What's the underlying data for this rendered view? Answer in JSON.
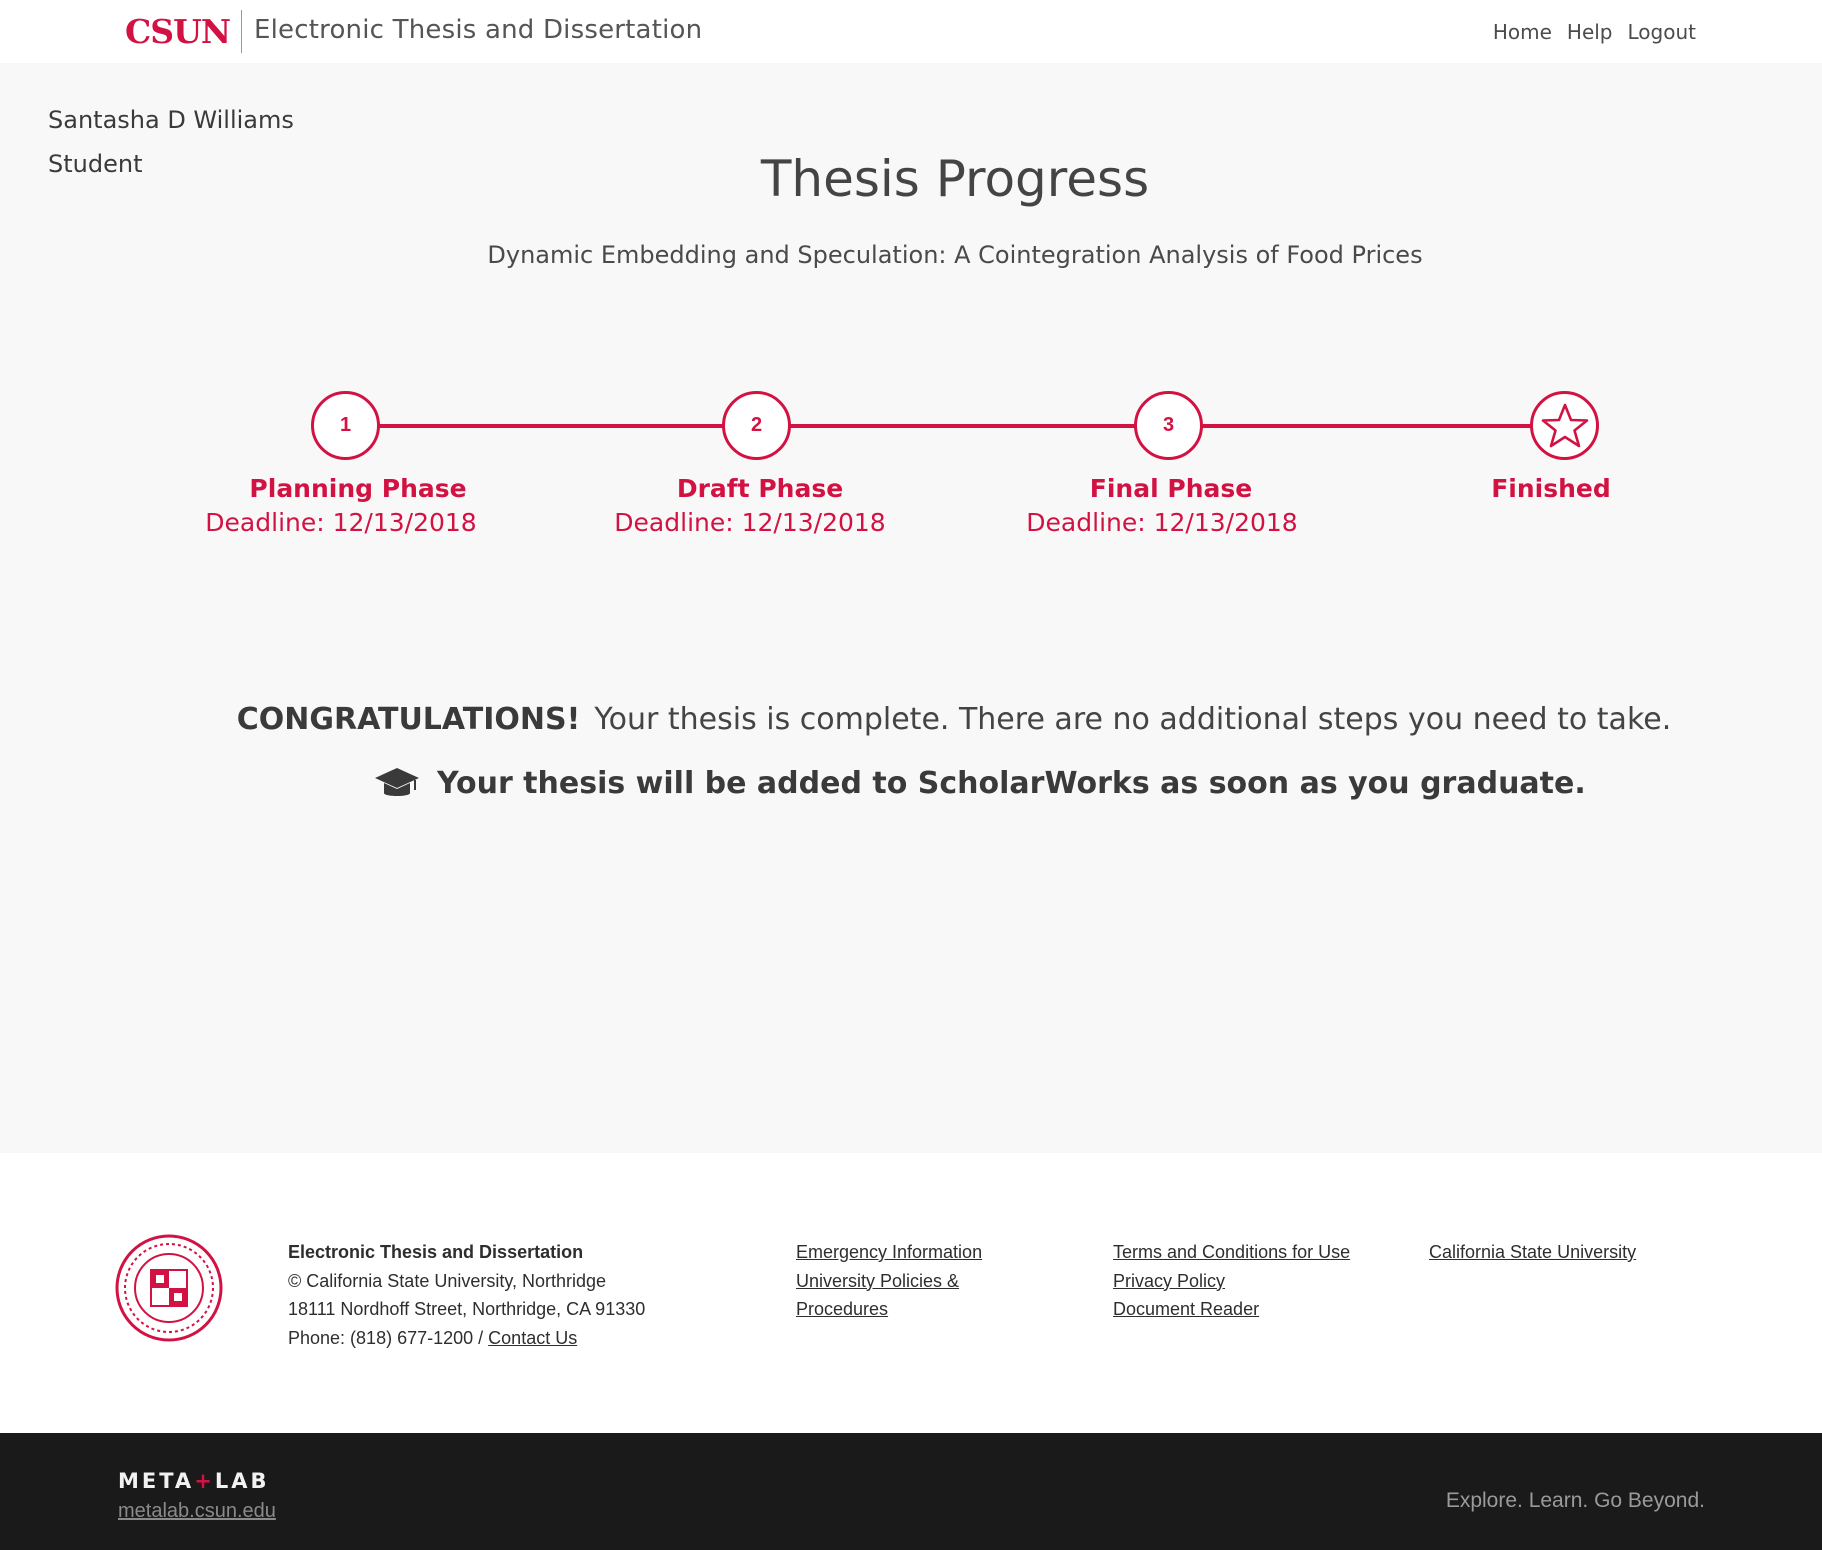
{
  "header": {
    "logo": "CSUN",
    "app_title": "Electronic Thesis and Dissertation",
    "nav": [
      {
        "label": "Home"
      },
      {
        "label": "Help"
      },
      {
        "label": "Logout"
      }
    ]
  },
  "user": {
    "name": "Santasha D Williams",
    "role": "Student"
  },
  "main": {
    "title": "Thesis Progress",
    "thesis_title": "Dynamic Embedding and Speculation: A Cointegration Analysis of Food Prices"
  },
  "steps": [
    {
      "number": "1",
      "label": "Planning Phase",
      "deadline": "Deadline: 12/13/2018"
    },
    {
      "number": "2",
      "label": "Draft Phase",
      "deadline": "Deadline: 12/13/2018"
    },
    {
      "number": "3",
      "label": "Final Phase",
      "deadline": "Deadline: 12/13/2018"
    },
    {
      "icon": "star-icon",
      "label": "Finished"
    }
  ],
  "completion": {
    "congrats_strong": "CONGRATULATIONS!",
    "congrats_text": "Your thesis is complete. There are no additional steps you need to take.",
    "scholarworks_icon": "graduation-cap-icon",
    "scholarworks_text": "Your thesis will be added to ScholarWorks as soon as you graduate."
  },
  "footer": {
    "seal_icon": "university-seal-icon",
    "org_title": "Electronic Thesis and Dissertation",
    "copyright": "© California State University, Northridge",
    "address": "18111 Nordhoff Street, Northridge, CA 91330",
    "phone": "Phone: (818) 677-1200 /",
    "contact_label": "Contact Us",
    "links_col1": [
      "Emergency Information",
      "University Policies &",
      "Procedures"
    ],
    "links_col2": [
      "Terms and Conditions for Use",
      "Privacy Policy",
      "Document Reader"
    ],
    "links_col3": [
      "California State University"
    ]
  },
  "bottom_band": {
    "logo_left": "META",
    "logo_plus": "+",
    "logo_right": "LAB",
    "url": "metalab.csun.edu",
    "tagline": "Explore. Learn. Go Beyond."
  },
  "colors": {
    "accent": "#d21242",
    "background": "#f8f8f8",
    "footer_dark": "#1a1a1a"
  }
}
